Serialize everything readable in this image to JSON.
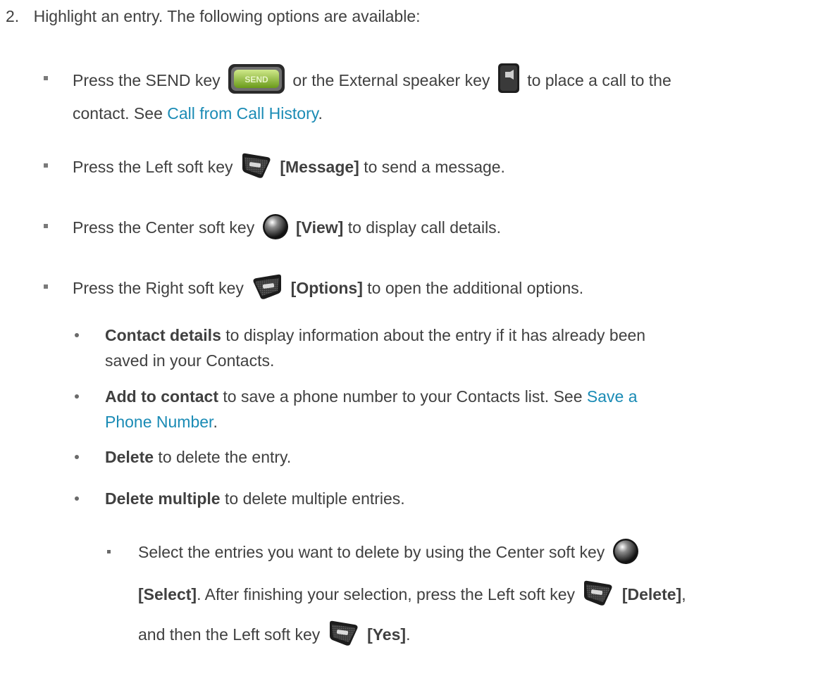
{
  "step": {
    "number": "2.",
    "text": "Highlight an entry. The following options are available:"
  },
  "items": [
    {
      "pre": "Press the SEND key",
      "mid": "or the External speaker key",
      "post": "to place a call to the",
      "line2": "contact. See ",
      "link": "Call from Call History",
      "end": "."
    },
    {
      "pre": "Press the Left soft key",
      "bold": "[Message]",
      "post": "to send a message."
    },
    {
      "pre": "Press the Center soft key",
      "bold": "[View]",
      "post": "to display call details."
    },
    {
      "pre": "Press the Right soft key",
      "bold": "[Options]",
      "post": "to open the additional options."
    }
  ],
  "subitems": [
    {
      "bold": "Contact details",
      "text": " to display information about the entry if it has already been",
      "line2": "saved in your Contacts."
    },
    {
      "bold": "Add to contact",
      "text": " to save a phone number to your Contacts list. See ",
      "link1": "Save a",
      "link2": "Phone Number",
      "end": "."
    },
    {
      "bold": "Delete",
      "text": " to delete the entry."
    },
    {
      "bold": "Delete multiple",
      "text": " to delete multiple entries."
    }
  ],
  "subsub": {
    "line1": "Select the entries you want to delete by using the Center soft key",
    "line2_bold1": "[Select]",
    "line2_text": ". After finishing your selection, press the Left soft key",
    "line2_bold2": "[Delete]",
    "line2_end": ",",
    "line3_text": "and then the Left soft key",
    "line3_bold": "[Yes]",
    "line3_end": "."
  },
  "icons": {
    "send_key": "send-key-icon",
    "speaker_key": "external-speaker-key-icon",
    "left_soft_key": "left-soft-key-icon",
    "center_soft_key": "center-soft-key-icon",
    "right_soft_key": "right-soft-key-icon",
    "send_text": "SEND",
    "link_color": "#1a8bb5"
  }
}
